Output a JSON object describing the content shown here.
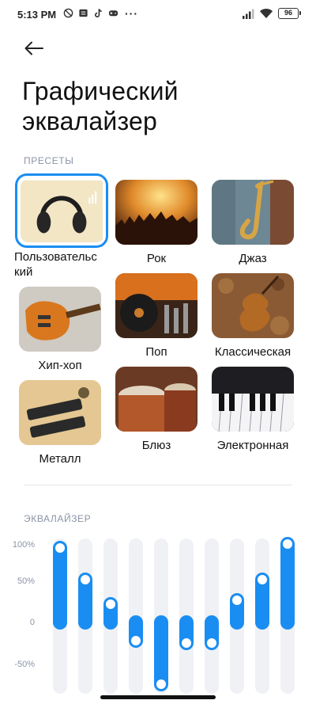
{
  "status_bar": {
    "time": "5:13 PM",
    "icons_left": [
      "do-not-disturb-icon",
      "message-icon",
      "tiktok-icon",
      "game-icon"
    ],
    "more": "···",
    "icons_right": [
      "signal-icon",
      "wifi-icon"
    ],
    "battery": "96"
  },
  "header": {
    "back_icon": "arrow-left-icon",
    "title": "Графический эквалайзер"
  },
  "presets": {
    "label": "ПРЕСЕТЫ",
    "selected": "Пользовательский",
    "items": [
      {
        "label": "Пользовательский",
        "display": "Пользовательс\nкий",
        "image": "headphones"
      },
      {
        "label": "Рок",
        "image": "concert-crowd"
      },
      {
        "label": "Джаз",
        "image": "saxophone"
      },
      {
        "label": "Хип-хоп",
        "image": "electric-guitar"
      },
      {
        "label": "Поп",
        "image": "dj-turntable"
      },
      {
        "label": "Классическая",
        "image": "violin"
      },
      {
        "label": "Металл",
        "image": "guitar-pickups"
      },
      {
        "label": "Блюз",
        "image": "tabla-drums"
      },
      {
        "label": "Электронная",
        "image": "piano-keys"
      }
    ]
  },
  "equalizer": {
    "label": "ЭКВАЛАЙЗЕР",
    "axis_labels": [
      "100%",
      "50%",
      "0",
      "-50%"
    ],
    "accent_color": "#1a8df2",
    "bands_percent": [
      90,
      52,
      22,
      -22,
      -75,
      -25,
      -25,
      27,
      52,
      95
    ]
  }
}
